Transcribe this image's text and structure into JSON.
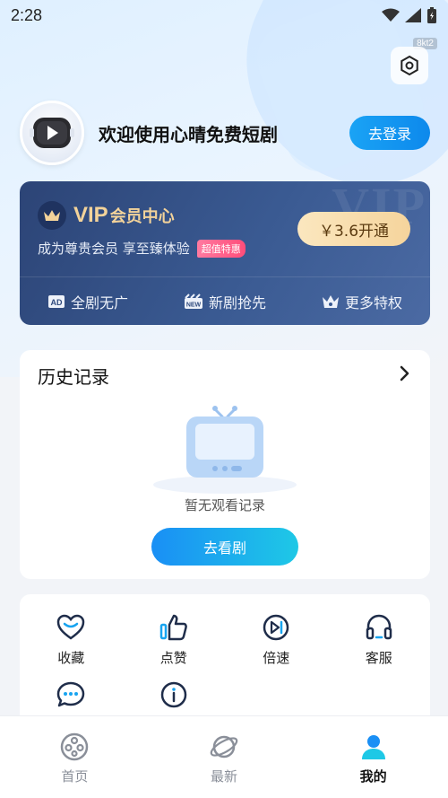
{
  "status_bar": {
    "time": "2:28"
  },
  "build_tag": "8kt2",
  "profile": {
    "welcome_text": "欢迎使用心晴免费短剧",
    "login_label": "去登录"
  },
  "vip": {
    "title_vip": "VIP",
    "title_center": "会员中心",
    "subtitle": "成为尊贵会员 享至臻体验",
    "tag": "超值特惠",
    "open_label": "￥3.6开通",
    "watermark": "VIP",
    "perks": [
      {
        "label": "全剧无广",
        "icon": "ad-icon"
      },
      {
        "label": "新剧抢先",
        "icon": "new-icon"
      },
      {
        "label": "更多特权",
        "icon": "crown-icon"
      }
    ]
  },
  "history": {
    "title": "历史记录",
    "empty_text": "暂无观看记录",
    "watch_label": "去看剧"
  },
  "tools": [
    {
      "label": "收藏",
      "icon": "heart-icon"
    },
    {
      "label": "点赞",
      "icon": "thumbs-up-icon"
    },
    {
      "label": "倍速",
      "icon": "speed-icon"
    },
    {
      "label": "客服",
      "icon": "headset-icon"
    },
    {
      "label": "",
      "icon": "chat-icon"
    },
    {
      "label": "",
      "icon": "info-icon"
    }
  ],
  "bottom_nav": [
    {
      "label": "首页",
      "icon": "film-reel-icon",
      "active": false
    },
    {
      "label": "最新",
      "icon": "planet-icon",
      "active": false
    },
    {
      "label": "我的",
      "icon": "person-icon",
      "active": true
    }
  ],
  "colors": {
    "primary_blue": "#1a8ff5",
    "vip_gold": "#f3d39a",
    "vip_bg": "#2c4476"
  }
}
